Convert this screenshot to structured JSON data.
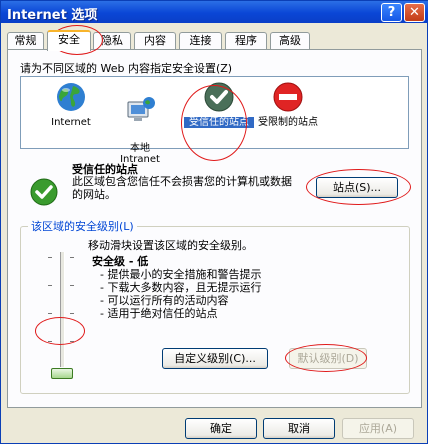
{
  "window": {
    "title": "Internet 选项",
    "help_glyph": "?",
    "close_glyph": "✕"
  },
  "tabs": [
    {
      "label": "常规"
    },
    {
      "label": "安全",
      "active": true
    },
    {
      "label": "隐私"
    },
    {
      "label": "内容"
    },
    {
      "label": "连接"
    },
    {
      "label": "程序"
    },
    {
      "label": "高级"
    }
  ],
  "security": {
    "zone_prompt": "请为不同区域的 Web 内容指定安全设置(Z)",
    "zones": [
      {
        "label": "Internet",
        "icon": "globe-icon"
      },
      {
        "label": "本地\nIntranet",
        "icon": "monitor-globe-icon"
      },
      {
        "label": "受信任的站点",
        "icon": "green-check-icon",
        "selected": true
      },
      {
        "label": "受限制的站点",
        "icon": "red-no-entry-icon"
      }
    ],
    "selected_zone": {
      "name": "受信任的站点",
      "description": "此区域包含您信任不会损害您的计算机或数据的网站。",
      "sites_button": "站点(S)..."
    },
    "level_group": {
      "title": "该区域的安全级别(L)",
      "hint": "移动滑块设置该区域的安全级别。",
      "level_name": "安全级 - 低",
      "items": [
        "提供最小的安全措施和警告提示",
        "下载大多数内容，且无提示运行",
        "可以运行所有的活动内容",
        "适用于绝对信任的站点"
      ],
      "custom_button": "自定义级别(C)...",
      "default_button": "默认级别(D)"
    }
  },
  "footer": {
    "ok": "确定",
    "cancel": "取消",
    "apply": "应用(A)"
  },
  "colors": {
    "title_bar": "#0a46d6",
    "selection": "#316ac5",
    "highlight_ring": "#e01a1a",
    "group_title": "#0046d5"
  }
}
